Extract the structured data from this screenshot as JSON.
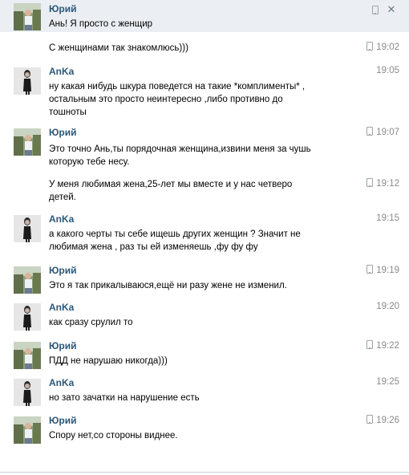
{
  "close_glyph": "✕",
  "messages": [
    {
      "sender": "Юрий",
      "time": "",
      "mobile": true,
      "lines": [
        "Ань! Я просто с женщир"
      ]
    },
    {
      "sender": "",
      "time": "19:02",
      "mobile": true,
      "lines": [
        "С женщинами так знакомлюсь)))"
      ]
    },
    {
      "sender": "AnKa",
      "time": "19:05",
      "mobile": false,
      "lines": [
        "ну какая нибудь шкура поведется на такие *комплименты* ,",
        "остальным это просто неинтересно ,либо противно до",
        "тошноты"
      ]
    },
    {
      "sender": "Юрий",
      "time": "19:07",
      "mobile": true,
      "lines": [
        "Это точно Ань,ты порядочная женщина,извини меня за чушь",
        "которую тебе несу."
      ]
    },
    {
      "sender": "",
      "time": "19:12",
      "mobile": true,
      "lines": [
        "У меня любимая жена,25-лет мы вместе и у нас четверо",
        "детей."
      ]
    },
    {
      "sender": "AnKa",
      "time": "19:15",
      "mobile": false,
      "lines": [
        "а какого черты ты себе ищешь других женщин ? Значит не",
        "любимая жена , раз ты ей изменяешь ,фу фу фу"
      ]
    },
    {
      "sender": "Юрий",
      "time": "19:19",
      "mobile": true,
      "lines": [
        "Это я так прикалываюся,ещё ни разу жене не изменил."
      ]
    },
    {
      "sender": "AnKa",
      "time": "19:20",
      "mobile": false,
      "lines": [
        "как сразу срулил то"
      ]
    },
    {
      "sender": "Юрий",
      "time": "19:22",
      "mobile": true,
      "lines": [
        "ПДД не нарушаю никогда)))"
      ]
    },
    {
      "sender": "AnKa",
      "time": "19:25",
      "mobile": false,
      "lines": [
        "но зато зачатки на нарушение есть"
      ]
    },
    {
      "sender": "Юрий",
      "time": "19:26",
      "mobile": true,
      "lines": [
        "Спору нет,со стороны виднее."
      ]
    }
  ]
}
